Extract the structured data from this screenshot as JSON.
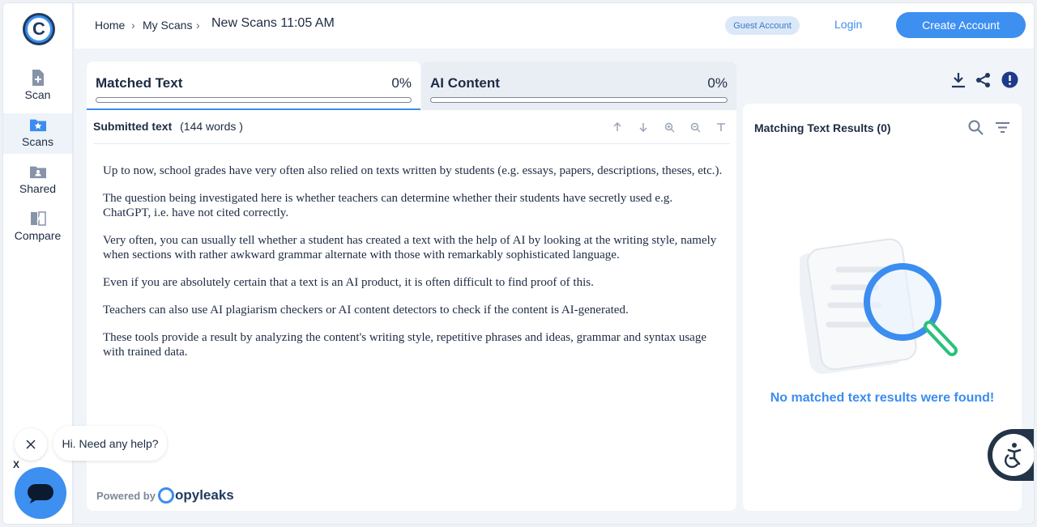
{
  "sidebar": {
    "items": [
      {
        "label": "Scan",
        "icon": "file-plus-icon"
      },
      {
        "label": "Scans",
        "icon": "folder-star-icon"
      },
      {
        "label": "Shared",
        "icon": "folder-user-icon"
      },
      {
        "label": "Compare",
        "icon": "compare-icon"
      }
    ]
  },
  "header": {
    "breadcrumb": [
      "Home",
      "My Scans"
    ],
    "title": "New Scans 11:05 AM",
    "guest_badge": "Guest Account",
    "login": "Login",
    "create_account": "Create Account"
  },
  "tabs": [
    {
      "name": "Matched Text",
      "percent": "0%",
      "progress": 0
    },
    {
      "name": "AI Content",
      "percent": "0%",
      "progress": 0
    }
  ],
  "submitted": {
    "label": "Submitted text",
    "word_count": "(144 words )",
    "paragraphs": [
      "Up to now, school grades have very often also relied on texts written by students (e.g. essays, papers, descriptions, theses, etc.).",
      "The question being investigated here is whether teachers can determine whether their students have secretly used e.g. ChatGPT, i.e. have not cited correctly.",
      "Very often, you can usually tell whether a student has created a text with the help of AI by looking at the writing style, namely when sections with rather awkward grammar alternate with those with remarkably sophisticated language.",
      "Even if you are absolutely certain that a text is an AI product, it is often difficult to find proof of this.",
      "Teachers can also use AI plagiarism checkers or AI content detectors to check if the content is AI-generated.",
      "These tools provide a result by analyzing the content's writing style, repetitive phrases and ideas, grammar and syntax usage with trained data."
    ],
    "powered_by": "Powered by",
    "brand": "opyleaks"
  },
  "results": {
    "title": "Matching Text Results (0)",
    "empty_message": "No matched text results were found!"
  },
  "chat": {
    "greeting": "Hi. Need any help?",
    "dismiss": "X"
  },
  "colors": {
    "accent": "#3b8df0",
    "dark": "#1d2b43"
  }
}
